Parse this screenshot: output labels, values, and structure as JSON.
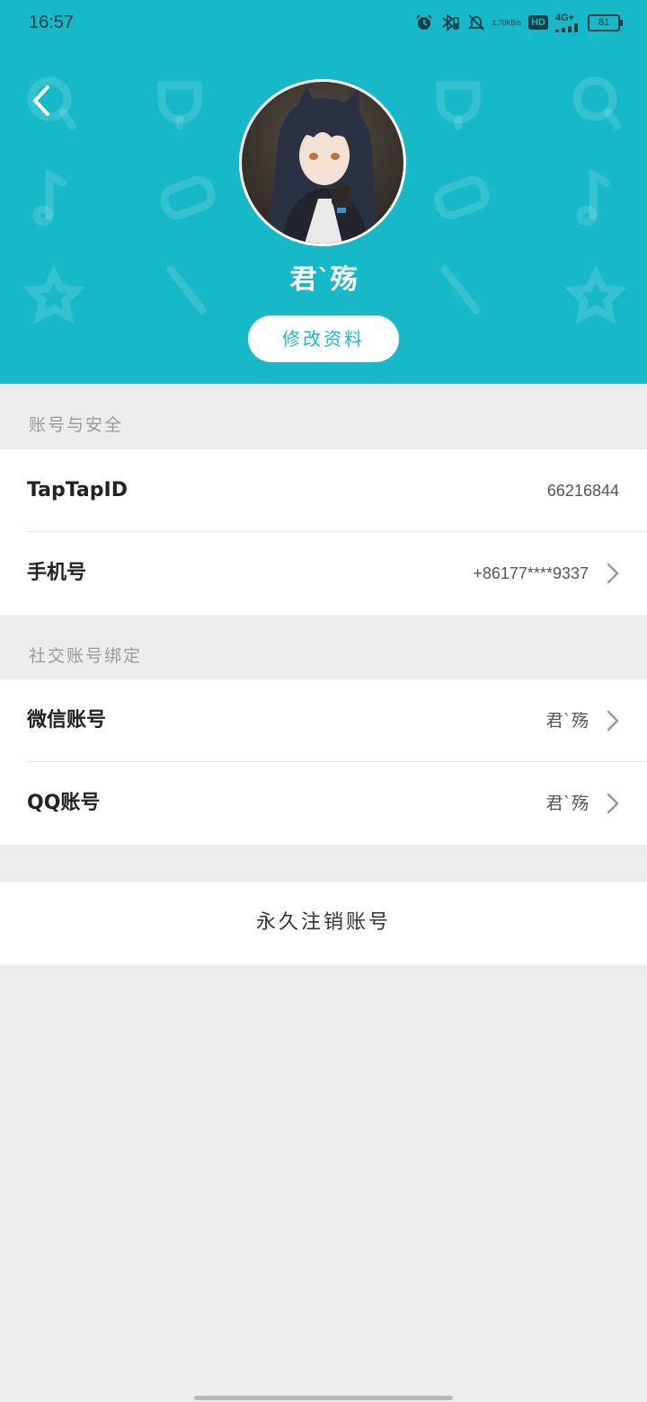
{
  "status_bar": {
    "time": "16:57",
    "speed_value": "1.70",
    "speed_unit": "KB/s",
    "hd": "HD",
    "network": "4G+",
    "battery": "81",
    "icons": [
      "alarm-icon",
      "bluetooth-icon",
      "mute-icon",
      "signal-icon"
    ]
  },
  "header": {
    "background_color": "#17b8c8",
    "username": "君`殇",
    "edit_profile_label": "修改资料",
    "avatar": "anime-character-avatar"
  },
  "account_section": {
    "title": "账号与安全",
    "rows": [
      {
        "label": "TapTapID",
        "value": "66216844"
      },
      {
        "label": "手机号",
        "value": "+86177****9337"
      }
    ]
  },
  "social_section": {
    "title": "社交账号绑定",
    "rows": [
      {
        "label": "微信账号",
        "value": "君`殇"
      },
      {
        "label": "QQ账号",
        "value": "君`殇"
      }
    ]
  },
  "delete_account_label": "永久注销账号"
}
